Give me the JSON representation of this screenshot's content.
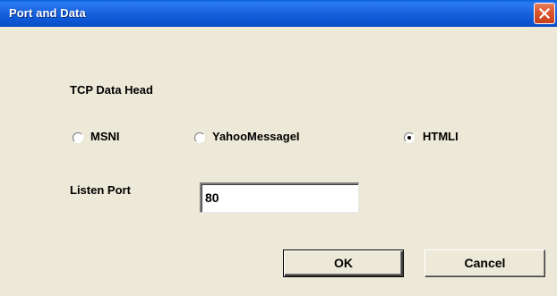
{
  "window": {
    "title": "Port and Data",
    "close_icon": "close-icon"
  },
  "tcp_section": {
    "label": "TCP Data Head",
    "options": [
      {
        "label": "MSNI",
        "checked": false
      },
      {
        "label": "YahooMessageI",
        "checked": false
      },
      {
        "label": "HTMLI",
        "checked": true
      }
    ]
  },
  "listen_port": {
    "label": "Listen Port",
    "value": "80"
  },
  "buttons": {
    "ok_label": "OK",
    "cancel_label": "Cancel"
  },
  "colors": {
    "titlebar": "#0b55d2",
    "window_bg": "#ece9d8",
    "close_button": "#d9532b"
  }
}
